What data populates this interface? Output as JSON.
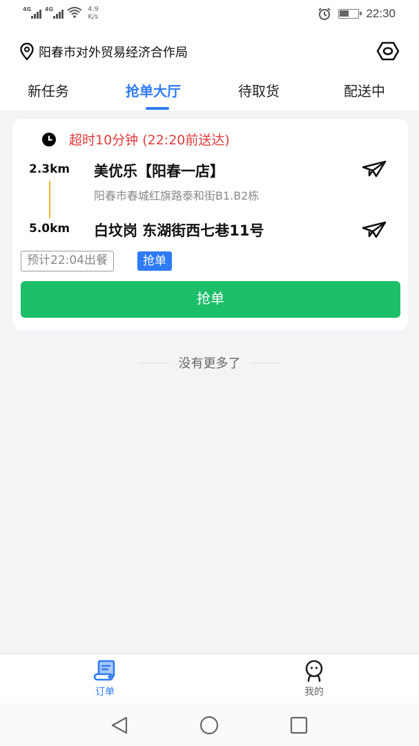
{
  "status_bar": {
    "sim1": "4G",
    "sim2": "4G",
    "speed_value": "4.9",
    "speed_unit": "K/s",
    "battery_level": 0.5,
    "time": "22:30"
  },
  "header": {
    "location": "阳春市对外贸易经济合作局",
    "location_icon": "map-pin-icon",
    "eye_icon": "eye-icon"
  },
  "tabs": [
    {
      "label": "新任务",
      "active": false
    },
    {
      "label": "抢单大厅",
      "active": true
    },
    {
      "label": "待取货",
      "active": false
    },
    {
      "label": "配送中",
      "active": false
    }
  ],
  "order": {
    "deadline": "超时10分钟 (22:20前送达)",
    "pickup": {
      "distance": "2.3km",
      "name": "美优乐【阳春一店】",
      "address": "阳春市春城红旗路泰和街B1.B2栋"
    },
    "dropoff": {
      "distance": "5.0km",
      "name": "白坟岗 东湖街西七巷11号"
    },
    "eta_tag": "预计22:04出餐",
    "grab_tag": "抢单",
    "grab_button": "抢单"
  },
  "list_end": "没有更多了",
  "bottom_nav": [
    {
      "label": "订单",
      "icon": "order-scroll-icon",
      "active": true
    },
    {
      "label": "我的",
      "icon": "profile-face-icon",
      "active": false
    }
  ],
  "colors": {
    "accent": "#2f7bf6",
    "success": "#1dbf6a",
    "warning_text": "#e03a3a",
    "route_line": "#f0b429"
  }
}
